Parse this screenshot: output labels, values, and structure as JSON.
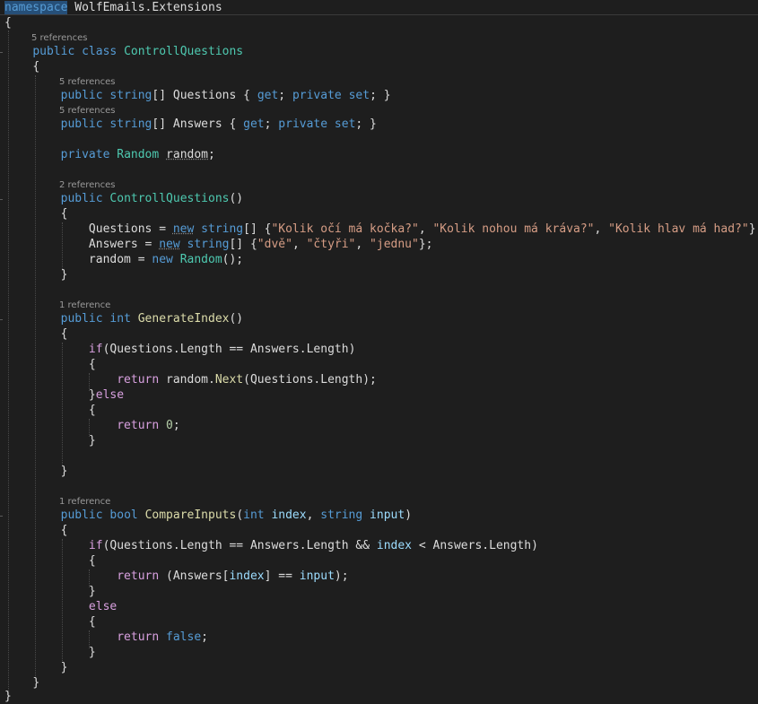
{
  "tokens": {
    "namespace": "namespace",
    "ns_name": "WolfEmails.Extensions",
    "ob": "{",
    "cb": "}",
    "public": "public",
    "private": "private",
    "class": "class",
    "string": "string",
    "int": "int",
    "bool": "bool",
    "new": "new",
    "if": "if",
    "else": "else",
    "return": "return",
    "get": "get",
    "set": "set",
    "false": "false",
    "Random": "Random",
    "ControllQuestions": "ControllQuestions",
    "Questions": "Questions",
    "Answers": "Answers",
    "random": "random",
    "GenerateIndex": "GenerateIndex",
    "CompareInputs": "CompareInputs",
    "Length": "Length",
    "Next": "Next",
    "index": "index",
    "input": "input",
    "zero": "0",
    "arr": "[]",
    "s1": "\"Kolik očí má kočka?\"",
    "s2": "\"Kolik nohou má kráva?\"",
    "s3": "\"Kolik hlav má had?\"",
    "s4": "\"dvě\"",
    "s5": "\"čtyři\"",
    "s6": "\"jednu\""
  },
  "refs": {
    "r5": "5 references",
    "r2": "2 references",
    "r1": "1 reference"
  }
}
